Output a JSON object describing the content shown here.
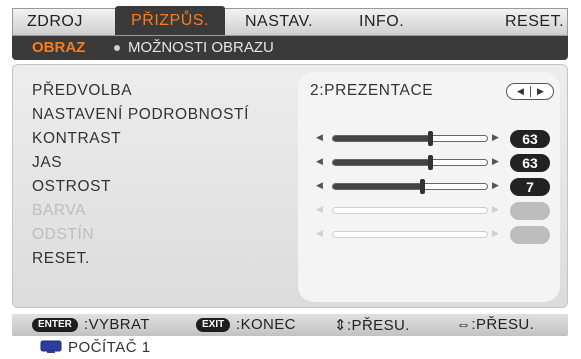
{
  "tabs": [
    {
      "label": "ZDROJ",
      "active": false
    },
    {
      "label": "PŘIZPŮS.",
      "active": true
    },
    {
      "label": "NASTAV.",
      "active": false
    },
    {
      "label": "INFO.",
      "active": false
    },
    {
      "label": "RESET.",
      "active": false
    }
  ],
  "breadcrumb": {
    "active": "OBRAZ",
    "other": "MOŽNOSTI OBRAZU"
  },
  "menu": {
    "predvolba": {
      "label": "PŘEDVOLBA",
      "value": "2:PREZENTACE"
    },
    "nastaveni": {
      "label": "NASTAVENÍ PODROBNOSTÍ"
    },
    "kontrast": {
      "label": "KONTRAST",
      "value": "63",
      "level": 0.63
    },
    "jas": {
      "label": "JAS",
      "value": "63",
      "level": 0.63
    },
    "ostrost": {
      "label": "OSTROST",
      "value": "7",
      "level": 0.58
    },
    "barva": {
      "label": "BARVA",
      "enabled": false
    },
    "odstin": {
      "label": "ODSTÍN",
      "enabled": false
    },
    "reset": {
      "label": "RESET."
    }
  },
  "help": {
    "enter_key": "ENTER",
    "enter_label": ":VYBRAT",
    "exit_key": "EXIT",
    "exit_label": ":KONEC",
    "updown": "⇕:PŘESU.",
    "leftright": "⇔:PŘESU."
  },
  "source": {
    "icon": "monitor-icon",
    "label": "POČÍTAČ 1"
  },
  "colors": {
    "accent": "#ff7a1a",
    "dark": "#3a3a3a"
  }
}
